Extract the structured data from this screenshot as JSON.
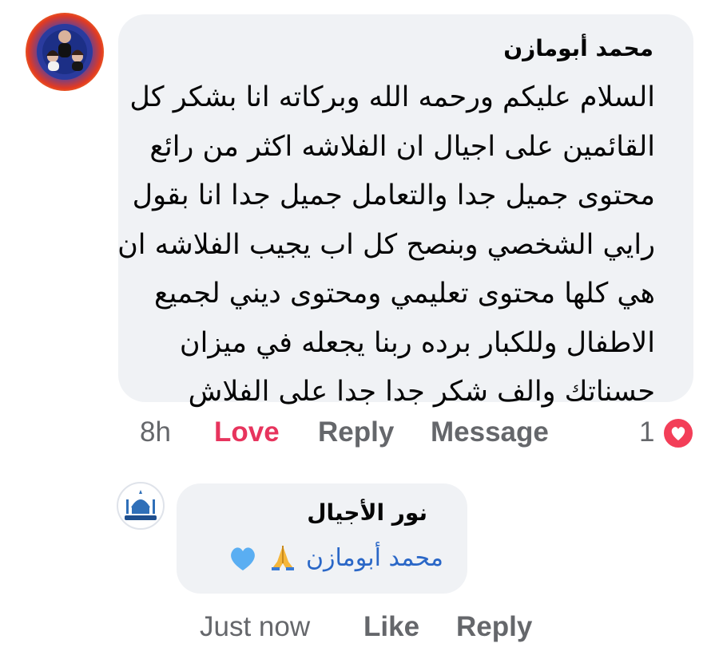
{
  "comment": {
    "author": "محمد أبومازن",
    "text_lines": [
      "السلام عليكم ورحمه الله وبركاته انا بشكر كل",
      "القائمين على اجيال ان الفلاشه اكثر من رائع",
      "محتوى جميل جدا والتعامل جميل جدا انا بقول",
      "رايي الشخصي وبنصح كل اب يجيب الفلاشه ان",
      "هي كلها محتوى تعليمي ومحتوى ديني لجميع",
      "الاطفال وللكبار برده ربنا يجعله في ميزان",
      "حسناتك والف شكر جدا جدا على الفلاش"
    ],
    "actions": {
      "time": "8h",
      "love": "Love",
      "reply": "Reply",
      "message": "Message"
    },
    "reaction": {
      "count": "1",
      "icon": "heart-reaction-icon",
      "color": "#f33e58"
    }
  },
  "reply": {
    "author": "نور الأجيال",
    "mention": "محمد أبومازن",
    "emojis": [
      "folded-hands-icon",
      "blue-heart-icon"
    ],
    "avatar_text": "نور الأجيال",
    "actions": {
      "time": "Just now",
      "like": "Like",
      "reply": "Reply"
    }
  },
  "colors": {
    "bubble": "#f0f2f5",
    "meta_text": "#65676b",
    "love": "#e7345d",
    "mention": "#2a67c7"
  }
}
